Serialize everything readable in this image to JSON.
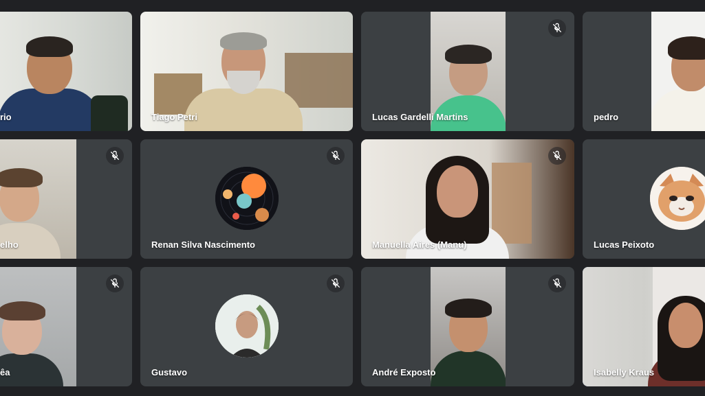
{
  "participants": [
    {
      "name": "rio",
      "muted": false
    },
    {
      "name": "Tiago Petri",
      "muted": false
    },
    {
      "name": "Lucas Gardelli Martins",
      "muted": true
    },
    {
      "name": "pedro",
      "muted": false
    },
    {
      "name": "elho",
      "muted": true
    },
    {
      "name": "Renan Silva Nascimento",
      "muted": true,
      "avatar": "planets-avatar"
    },
    {
      "name": "Manuella Aires (Manu)",
      "muted": true
    },
    {
      "name": "Lucas Peixoto",
      "muted": false,
      "avatar": "cat-avatar"
    },
    {
      "name": "êa",
      "muted": true
    },
    {
      "name": "Gustavo",
      "muted": true,
      "avatar": "profile-photo-avatar"
    },
    {
      "name": "André Exposto",
      "muted": true
    },
    {
      "name": "Isabelly Kraus",
      "muted": false,
      "active_speaker": true
    }
  ],
  "icons": {
    "muted_mic": "mic-off-icon"
  },
  "colors": {
    "background": "#202124",
    "tile": "#3c4043",
    "active_outline": "#8ab4f8",
    "text": "#ffffff"
  }
}
